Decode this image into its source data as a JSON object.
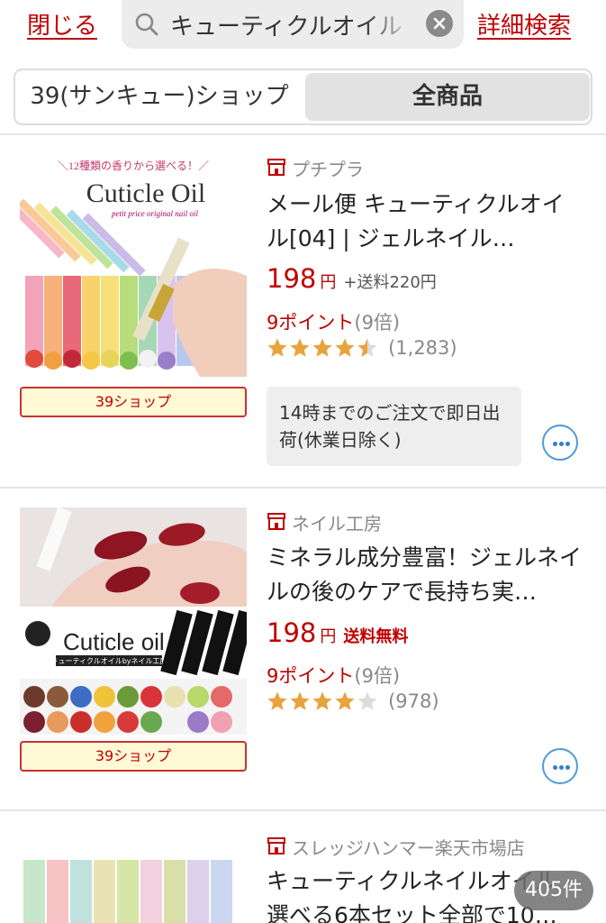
{
  "header": {
    "close_label": "閉じる",
    "search_value": "キューティクルオイル",
    "advanced_label": "詳細検索"
  },
  "filter": {
    "shop_label": "39(サンキュー)ショップ",
    "all_label": "全商品",
    "selected": "全商品"
  },
  "products": [
    {
      "shop": "プチプラ",
      "title": "メール便 キューティクルオイル[04] | ジェルネイル…",
      "price": "198",
      "yen": "円",
      "shipping": "+送料220円",
      "points": "9ポイント",
      "points_mult": "(9倍)",
      "rating": 4.5,
      "reviews": "(1,283)",
      "badge": "39ショップ",
      "note": "14時までのご注文で即日出荷(休業日除く)",
      "image": {
        "banner": "＼12種類の香りから選べる！／",
        "heading": "Cuticle Oil",
        "subheading": "petit price original nail oil"
      }
    },
    {
      "shop": "ネイル工房",
      "title": "ミネラル成分豊富！ジェルネイルの後のケアで長持ち実…",
      "price": "198",
      "yen": "円",
      "shipping": "送料無料",
      "points": "9ポイント",
      "points_mult": "(9倍)",
      "rating": 4.0,
      "reviews": "(978)",
      "badge": "39ショップ",
      "image": {
        "heading": "Cuticle oil",
        "caption": "キューティクルオイルbyネイル工房"
      }
    },
    {
      "shop": "スレッジハンマー楽天市場店",
      "title": "キューティクルネイルオイル 選べる6本セット全部で10…"
    }
  ],
  "result_count": "405件",
  "colors": {
    "accent": "#bf0000",
    "star": "#e8a33c",
    "link_blue": "#2f7fca"
  }
}
